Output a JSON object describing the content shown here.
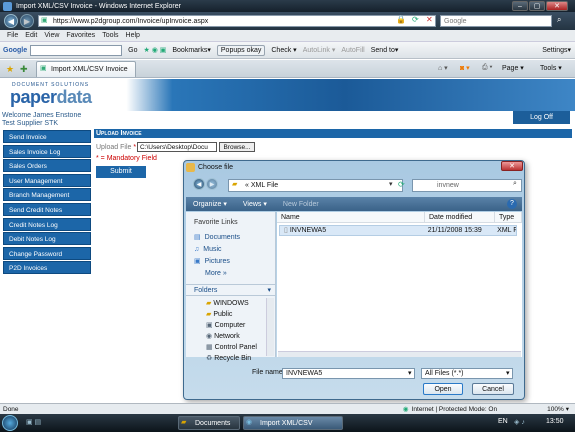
{
  "window": {
    "title": "Import XML/CSV Invoice - Windows Internet Explorer",
    "min": "–",
    "max": "▢",
    "close": "✕"
  },
  "address": {
    "url": "https://www.p2dgroup.com/Invoice/upInvoice.aspx",
    "search_placeholder": "Google"
  },
  "menu": [
    "File",
    "Edit",
    "View",
    "Favorites",
    "Tools",
    "Help"
  ],
  "gtoolbar": {
    "google": "Google",
    "go": "Go",
    "bookmarks": "Bookmarks▾",
    "popups": "Popups okay",
    "check": "Check ▾",
    "autolink": "AutoLink ▾",
    "autofill": "AutoFill",
    "sendto": "Send to▾",
    "settings": "Settings▾"
  },
  "tabbar": {
    "tab_title": "Import XML/CSV Invoice",
    "page": "Page ▾",
    "tools": "Tools ▾"
  },
  "site": {
    "logo_small": "DOCUMENT SOLUTIONS",
    "logo_a": "paper",
    "logo_b": "data",
    "welcome": "Welcome James Enstone",
    "supplier": "Test Supplier STK",
    "logoff": "Log Off"
  },
  "sidebar": [
    "Send Invoice",
    "Sales Invoice Log",
    "Sales Orders",
    "User Management",
    "Branch Management",
    "Send Credit Notes",
    "Credit Notes Log",
    "Debit Notes Log",
    "Change Password",
    "P2D Invoices"
  ],
  "upload": {
    "title": "Upload Invoice",
    "label": "Upload File",
    "star": "*",
    "field_value": "C:\\Users\\Desktop\\Docu",
    "browse": "Browse...",
    "mandatory": "* = Mandatory Field",
    "submit": "Submit"
  },
  "dialog": {
    "title": "Choose file",
    "close": "✕",
    "path": "« XML File",
    "search": "invnew",
    "organize": "Organize ▾",
    "views": "Views ▾",
    "new_folder": "New Folder",
    "help": "?",
    "fav_heading": "Favorite Links",
    "favorites": [
      "Documents",
      "Music",
      "Pictures"
    ],
    "more": "More »",
    "folders_heading": "Folders",
    "folders": [
      "WINDOWS",
      "Public",
      "Computer",
      "Network",
      "Control Panel",
      "Recycle Bin"
    ],
    "columns": [
      "Name",
      "Date modified",
      "Type"
    ],
    "files": [
      {
        "name": "INVNEWA5",
        "date": "21/11/2008 15:39",
        "type": "XML File"
      }
    ],
    "filename_label": "File name:",
    "filename_value": "INVNEWA5",
    "filetype": "All Files (*.*)",
    "open": "Open",
    "cancel": "Cancel"
  },
  "status": {
    "left": "Done",
    "zone": "Internet | Protected Mode: On",
    "zoom": "100%"
  },
  "taskbar": {
    "tasks": [
      "Documents",
      "Import XML/CSV Invoice..."
    ],
    "lang": "EN",
    "clock": "13:50"
  },
  "colors": {
    "accent": "#1c66a8",
    "banner": "#2a76b8",
    "error": "#cc0000"
  }
}
